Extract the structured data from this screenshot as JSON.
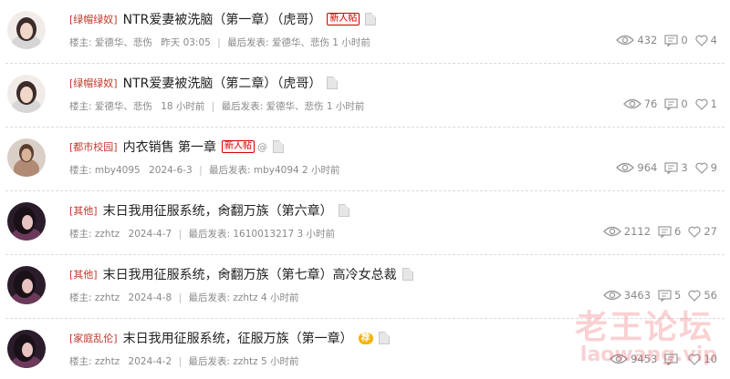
{
  "labels": {
    "author_prefix": "楼主:",
    "last_post_prefix": "最后发表:"
  },
  "threads": [
    {
      "category": "[绿帽绿奴]",
      "title": "NTR爱妻被洗脑（第一章）（虎哥）",
      "tag": "新人帖",
      "author": "爱德华、悲伤",
      "date": "昨天 03:05",
      "last_poster": "爱德华、悲伤 1 小时前",
      "views": "432",
      "replies": "0",
      "likes": "4",
      "avatar": "a1",
      "clip": false
    },
    {
      "category": "[绿帽绿奴]",
      "title": "NTR爱妻被洗脑（第二章）（虎哥）",
      "tag": "",
      "author": "爱德华、悲伤",
      "date": "18 小时前",
      "last_poster": "爱德华、悲伤 1 小时前",
      "views": "76",
      "replies": "0",
      "likes": "1",
      "avatar": "a1",
      "clip": false
    },
    {
      "category": "[都市校园]",
      "title": "内衣销售 第一章",
      "tag": "新人帖",
      "author": "mby4095",
      "date": "2024-6-3",
      "last_poster": "mby4094 2 小时前",
      "views": "964",
      "replies": "3",
      "likes": "9",
      "avatar": "a2",
      "clip": true
    },
    {
      "category": "[其他]",
      "title": "末日我用征服系统，肏翻万族（第六章）",
      "tag": "",
      "author": "zzhtz",
      "date": "2024-4-7",
      "last_poster": "1610013217 3 小时前",
      "views": "2112",
      "replies": "6",
      "likes": "27",
      "avatar": "a3",
      "clip": false
    },
    {
      "category": "[其他]",
      "title": "末日我用征服系统，肏翻万族（第七章）高冷女总裁",
      "tag": "",
      "author": "zzhtz",
      "date": "2024-4-8",
      "last_poster": "zzhtz 4 小时前",
      "views": "3463",
      "replies": "5",
      "likes": "56",
      "avatar": "a3",
      "clip": false
    },
    {
      "category": "[家庭乱伦]",
      "title": "末日我用征服系统，征服万族（第一章）",
      "tag": "荐",
      "author": "zzhtz",
      "date": "2024-4-2",
      "last_poster": "zzhtz 5 小时前",
      "views": "9453",
      "replies": "",
      "likes": "10",
      "avatar": "a3",
      "clip": false
    }
  ],
  "watermark": {
    "name": "老王论坛",
    "url": "laowang.vip"
  },
  "colors": {
    "category": "#c0392b",
    "new_tag": "#d40000",
    "rec_tag": "#f1b400",
    "watermark": "#e8343a"
  }
}
